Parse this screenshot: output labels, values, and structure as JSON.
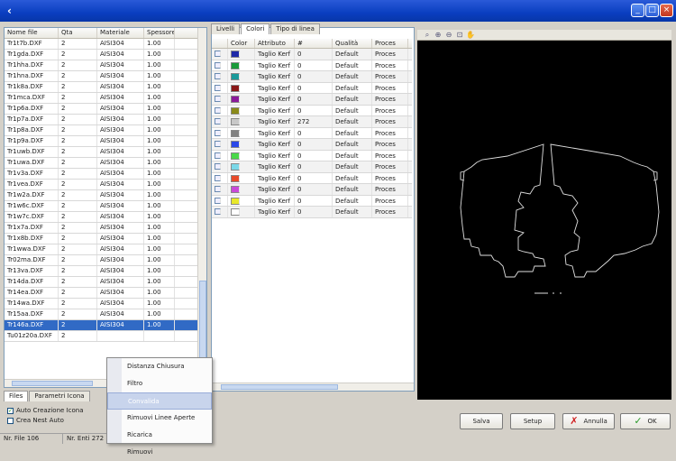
{
  "window": {
    "icon": "app-icon",
    "controls": [
      "minimize-icon",
      "maximize-icon",
      "close-icon"
    ]
  },
  "files": {
    "columns": [
      "Nome file",
      "Qta",
      "Materiale",
      "Spessore"
    ],
    "rows": [
      [
        "Tr1t7b.DXF",
        "2",
        "AISI304",
        "1.00"
      ],
      [
        "Tr1gda.DXF",
        "2",
        "AISI304",
        "1.00"
      ],
      [
        "Tr1hha.DXF",
        "2",
        "AISI304",
        "1.00"
      ],
      [
        "Tr1hna.DXF",
        "2",
        "AISI304",
        "1.00"
      ],
      [
        "Tr1k8a.DXF",
        "2",
        "AISI304",
        "1.00"
      ],
      [
        "Tr1mca.DXF",
        "2",
        "AISI304",
        "1.00"
      ],
      [
        "Tr1p6a.DXF",
        "2",
        "AISI304",
        "1.00"
      ],
      [
        "Tr1p7a.DXF",
        "2",
        "AISI304",
        "1.00"
      ],
      [
        "Tr1p8a.DXF",
        "2",
        "AISI304",
        "1.00"
      ],
      [
        "Tr1p9a.DXF",
        "2",
        "AISI304",
        "1.00"
      ],
      [
        "Tr1uwb.DXF",
        "2",
        "AISI304",
        "1.00"
      ],
      [
        "Tr1uwa.DXF",
        "2",
        "AISI304",
        "1.00"
      ],
      [
        "Tr1v3a.DXF",
        "2",
        "AISI304",
        "1.00"
      ],
      [
        "Tr1vea.DXF",
        "2",
        "AISI304",
        "1.00"
      ],
      [
        "Tr1w2a.DXF",
        "2",
        "AISI304",
        "1.00"
      ],
      [
        "Tr1w6c.DXF",
        "2",
        "AISI304",
        "1.00"
      ],
      [
        "Tr1w7c.DXF",
        "2",
        "AISI304",
        "1.00"
      ],
      [
        "Tr1x7a.DXF",
        "2",
        "AISI304",
        "1.00"
      ],
      [
        "Tr1x8b.DXF",
        "2",
        "AISI304",
        "1.00"
      ],
      [
        "Tr1wwa.DXF",
        "2",
        "AISI304",
        "1.00"
      ],
      [
        "Tr02ma.DXF",
        "2",
        "AISI304",
        "1.00"
      ],
      [
        "Tr13va.DXF",
        "2",
        "AISI304",
        "1.00"
      ],
      [
        "Tr14da.DXF",
        "2",
        "AISI304",
        "1.00"
      ],
      [
        "Tr14ea.DXF",
        "2",
        "AISI304",
        "1.00"
      ],
      [
        "Tr14wa.DXF",
        "2",
        "AISI304",
        "1.00"
      ],
      [
        "Tr15aa.DXF",
        "2",
        "AISI304",
        "1.00"
      ],
      [
        "Tr146a.DXF",
        "2",
        "AISI304",
        "1.00"
      ],
      [
        "Tu01z20a.DXF",
        "2",
        "",
        ""
      ]
    ],
    "selected_index": 26
  },
  "left_tabs": [
    "Files",
    "Parametri Icona"
  ],
  "options": [
    {
      "label": "Auto Creazione Icona",
      "checked": true
    },
    {
      "label": "Crea Nest Auto",
      "checked": false
    }
  ],
  "status": {
    "files": "Nr. File 106",
    "entities": "Nr. Enti 272"
  },
  "context_menu": {
    "items": [
      "Distanza Chiusura",
      "Filtro",
      "Convalida",
      "Rimuovi Linee Aperte",
      "Ricarica",
      "Rimuovi"
    ],
    "highlighted": 2
  },
  "layer_tabs": [
    "Livelli",
    "Colori",
    "Tipo di linea"
  ],
  "active_layer_tab": 1,
  "colors_table": {
    "columns": [
      "",
      "Color",
      "Attributo",
      "#",
      "Qualità",
      "Proces"
    ],
    "rows": [
      {
        "color": "#1f2aa8",
        "attributo": "Taglio Kerf",
        "count": "0",
        "qualita": "Default",
        "proces": "Proces"
      },
      {
        "color": "#1a9a3a",
        "attributo": "Taglio Kerf",
        "count": "0",
        "qualita": "Default",
        "proces": "Proces"
      },
      {
        "color": "#1a9a9a",
        "attributo": "Taglio Kerf",
        "count": "0",
        "qualita": "Default",
        "proces": "Proces"
      },
      {
        "color": "#8a1818",
        "attributo": "Taglio Kerf",
        "count": "0",
        "qualita": "Default",
        "proces": "Proces"
      },
      {
        "color": "#8a1a9a",
        "attributo": "Taglio Kerf",
        "count": "0",
        "qualita": "Default",
        "proces": "Proces"
      },
      {
        "color": "#8a8a1a",
        "attributo": "Taglio Kerf",
        "count": "0",
        "qualita": "Default",
        "proces": "Proces"
      },
      {
        "color": "#c8c8c8",
        "attributo": "Taglio Kerf",
        "count": "272",
        "qualita": "Default",
        "proces": "Proces"
      },
      {
        "color": "#808080",
        "attributo": "Taglio Kerf",
        "count": "0",
        "qualita": "Default",
        "proces": "Proces"
      },
      {
        "color": "#2a48e8",
        "attributo": "Taglio Kerf",
        "count": "0",
        "qualita": "Default",
        "proces": "Proces"
      },
      {
        "color": "#4ad84a",
        "attributo": "Taglio Kerf",
        "count": "0",
        "qualita": "Default",
        "proces": "Proces"
      },
      {
        "color": "#7ad8e8",
        "attributo": "Taglio Kerf",
        "count": "0",
        "qualita": "Default",
        "proces": "Proces"
      },
      {
        "color": "#e84a2a",
        "attributo": "Taglio Kerf",
        "count": "0",
        "qualita": "Default",
        "proces": "Proces"
      },
      {
        "color": "#c84ad8",
        "attributo": "Taglio Kerf",
        "count": "0",
        "qualita": "Default",
        "proces": "Proces"
      },
      {
        "color": "#e8e82a",
        "attributo": "Taglio Kerf",
        "count": "0",
        "qualita": "Default",
        "proces": "Proces"
      },
      {
        "color": "#ffffff",
        "attributo": "Taglio Kerf",
        "count": "0",
        "qualita": "Default",
        "proces": "Proces"
      }
    ]
  },
  "toolbar_icons": [
    "zoom-window-icon",
    "zoom-in-icon",
    "zoom-out-icon",
    "zoom-extents-icon",
    "pan-icon"
  ],
  "buttons": {
    "salva": "Salva",
    "setup": "Setup",
    "annulla": "Annulla",
    "ok": "OK"
  }
}
